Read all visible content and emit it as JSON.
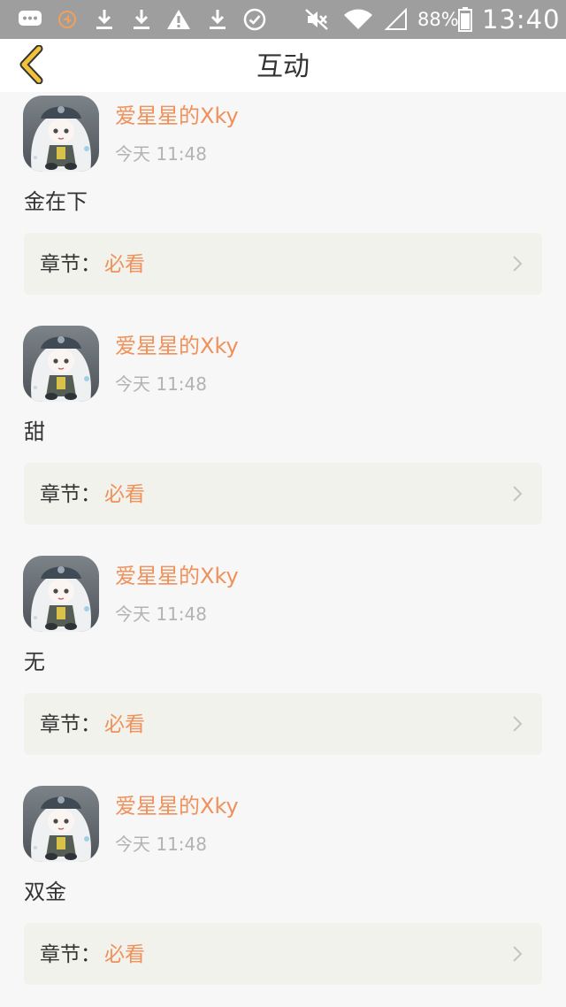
{
  "status_bar": {
    "battery_percent": "88%",
    "time": "13:40",
    "icons": [
      "chat-icon",
      "notification-icon",
      "download-icon",
      "download-icon",
      "warning-icon",
      "download-icon",
      "check-circle-icon",
      "mute-icon",
      "wifi-icon",
      "signal-icon",
      "battery-icon"
    ]
  },
  "nav": {
    "title": "互动",
    "back_icon": "chevron-left-icon"
  },
  "colors": {
    "accent": "#f0905a",
    "back_arrow": "#f2c23a",
    "status_bar": "#9e9e9e",
    "card_bg": "#f2f2ec"
  },
  "posts": [
    {
      "username": "爱星星的Xky",
      "time": "今天 11:48",
      "comment": "金在下",
      "chapter_prefix": "章节：",
      "chapter_name": "必看"
    },
    {
      "username": "爱星星的Xky",
      "time": "今天 11:48",
      "comment": "甜",
      "chapter_prefix": "章节：",
      "chapter_name": "必看"
    },
    {
      "username": "爱星星的Xky",
      "time": "今天 11:48",
      "comment": "无",
      "chapter_prefix": "章节：",
      "chapter_name": "必看"
    },
    {
      "username": "爱星星的Xky",
      "time": "今天 11:48",
      "comment": "双金",
      "chapter_prefix": "章节：",
      "chapter_name": "必看"
    }
  ]
}
